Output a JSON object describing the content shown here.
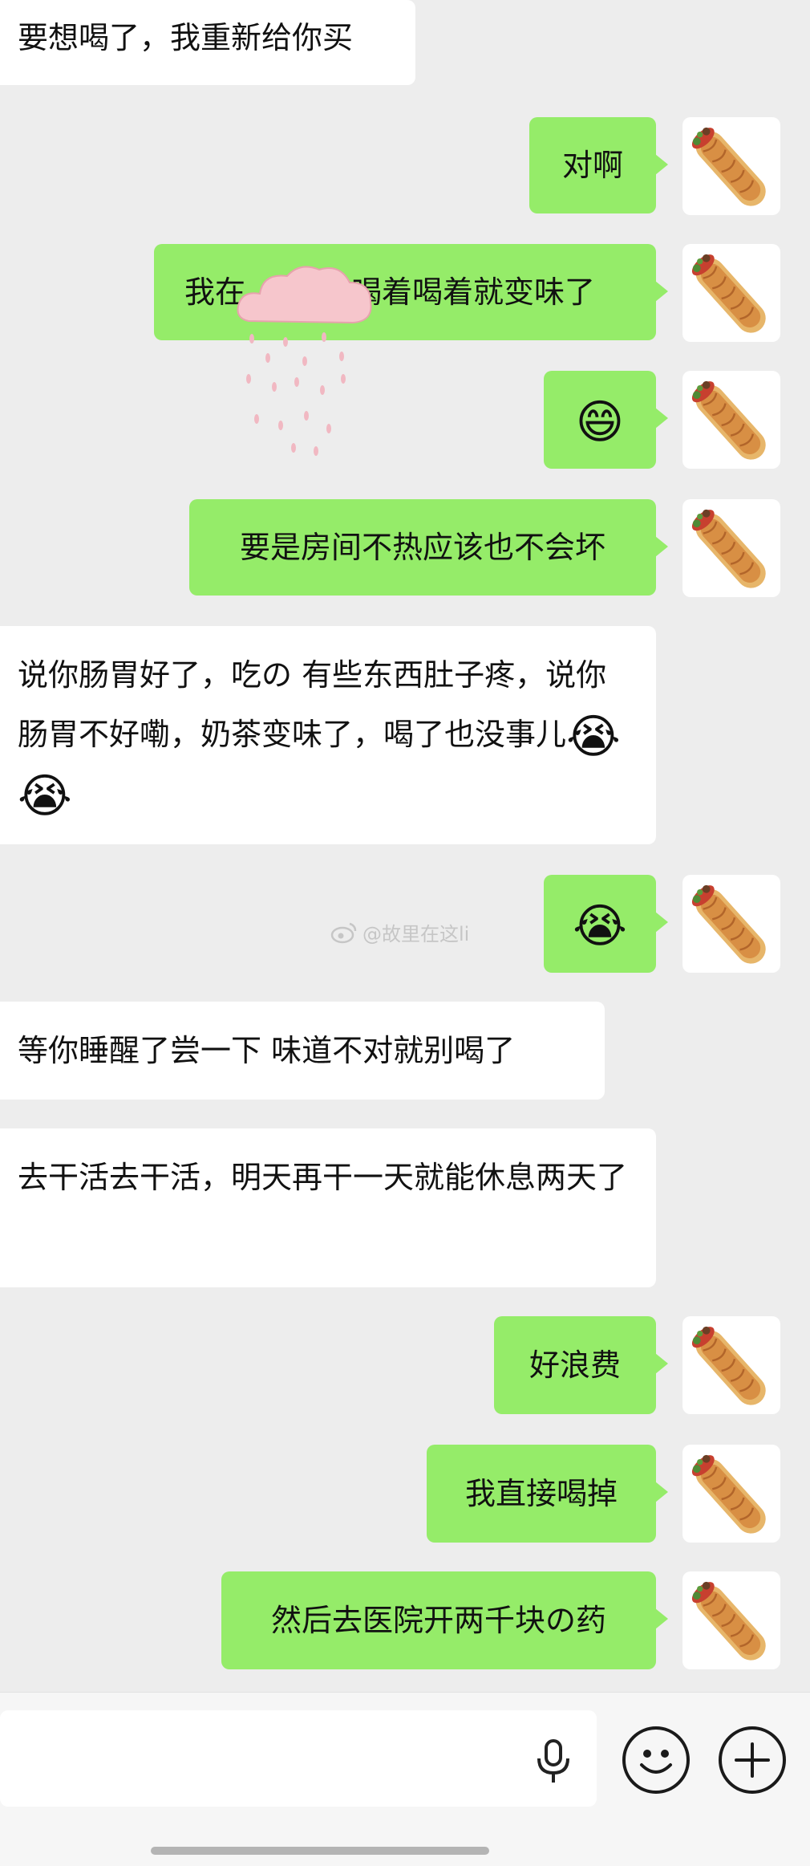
{
  "messages": [
    {
      "side": "in",
      "text": "要想喝了，我重新给你买"
    },
    {
      "side": "out",
      "text": "对啊"
    },
    {
      "side": "out",
      "prefix": "我在",
      "suffix": "喝着喝着就变味了",
      "sticker": "raining-cloud-sticker"
    },
    {
      "side": "out",
      "emoji": "😄"
    },
    {
      "side": "out",
      "text": "要是房间不热应该也不会坏"
    },
    {
      "side": "in",
      "text": "说你肠胃好了，吃の 有些东西肚子疼，说你肠胃不好嘞，奶茶变味了，喝了也没事儿",
      "emojis": "😭😭"
    },
    {
      "side": "out",
      "emoji": "😭"
    },
    {
      "side": "in",
      "text": "等你睡醒了尝一下 味道不对就别喝了"
    },
    {
      "side": "in",
      "text": "去干活去干活，明天再干一天就能休息两天了"
    },
    {
      "side": "out",
      "text": "好浪费"
    },
    {
      "side": "out",
      "text": "我直接喝掉"
    },
    {
      "side": "out",
      "text": "然后去医院开两千块の药"
    }
  ],
  "watermark": "@故里在这li",
  "input": {
    "value": "",
    "placeholder": ""
  },
  "icons": {
    "voice": "microphone-icon",
    "emoji": "smiley-icon",
    "more": "plus-icon",
    "avatar": "burrito-avatar",
    "watermark": "weibo-icon"
  },
  "colors": {
    "background": "#ededed",
    "outgoing_bubble": "#95ec69",
    "incoming_bubble": "#ffffff",
    "text": "#111111",
    "bottom_bar": "#f6f6f6"
  }
}
